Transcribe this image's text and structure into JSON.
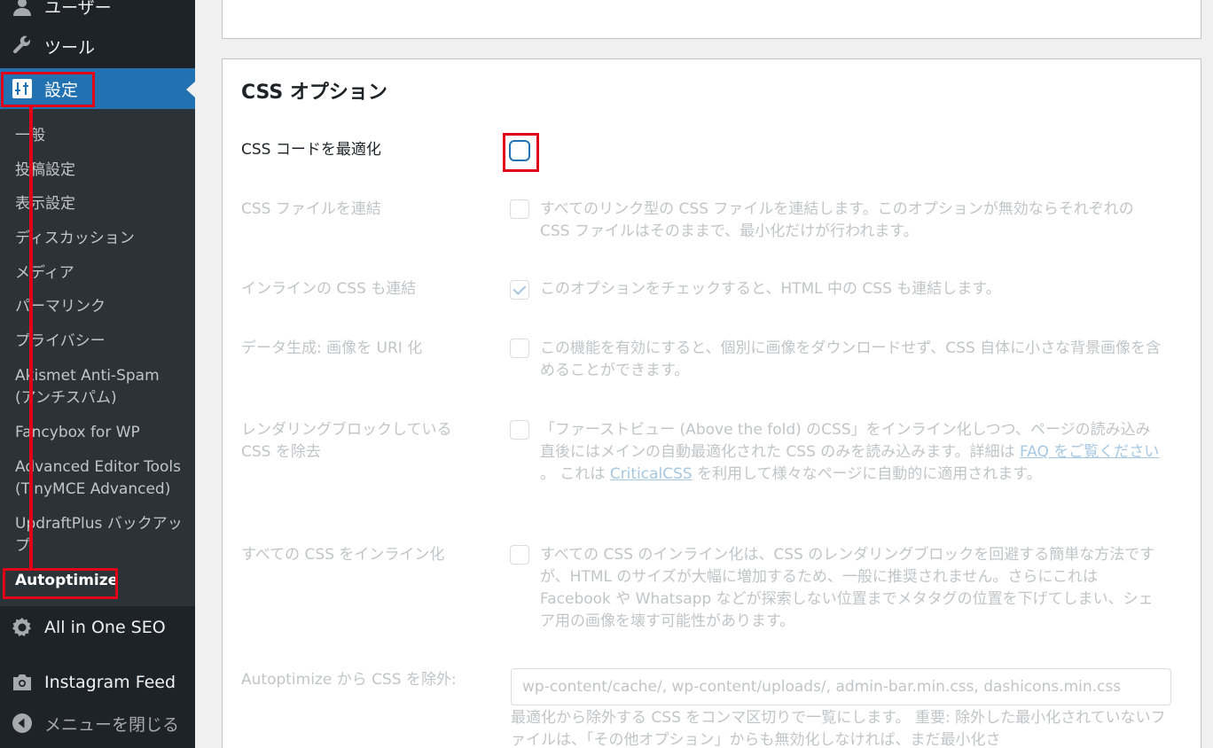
{
  "sidebar": {
    "users_label": "ユーザー",
    "tools_label": "ツール",
    "settings_label": "設定",
    "submenu": [
      "一般",
      "投稿設定",
      "表示設定",
      "ディスカッション",
      "メディア",
      "パーマリンク",
      "プライバシー",
      "Akismet Anti-Spam (アンチスパム)",
      "Fancybox for WP",
      "Advanced Editor Tools (TinyMCE Advanced)",
      "UpdraftPlus バックアップ",
      "Autoptimize"
    ],
    "aioseo_label": "All in One SEO",
    "instagram_label": "Instagram Feed",
    "collapse_label": "メニューを閉じる"
  },
  "css_options": {
    "title": "CSS オプション",
    "optimize": {
      "label": "CSS コードを最適化",
      "checked": false
    },
    "aggregate": {
      "label": "CSS ファイルを連結",
      "checked": false,
      "desc": "すべてのリンク型の CSS ファイルを連結します。このオプションが無効ならそれぞれの CSS ファイルはそのままで、最小化だけが行われます。"
    },
    "inline_aggregate": {
      "label": "インラインの CSS も連結",
      "checked": true,
      "desc": "このオプションをチェックすると、HTML 中の CSS も連結します。"
    },
    "datauri": {
      "label": "データ生成: 画像を URI 化",
      "checked": false,
      "desc": "この機能を有効にすると、個別に画像をダウンロードせず、CSS 自体に小さな背景画像を含めることができます。"
    },
    "render_blocking": {
      "label": "レンダリングブロックしている CSS を除去",
      "checked": false,
      "desc_before": "「ファーストビュー (Above the fold) のCSS」をインライン化しつつ、ページの読み込み直後にはメインの自動最適化された CSS のみを読み込みます。詳細は ",
      "faq_link": "FAQ をご覧ください",
      "desc_middle": " 。 これは ",
      "criticalcss_link": "CriticalCSS",
      "desc_after": " を利用して様々なページに自動的に適用されます。"
    },
    "inline_all": {
      "label": "すべての CSS をインライン化",
      "checked": false,
      "desc": "すべての CSS のインライン化は、CSS のレンダリングブロックを回避する簡単な方法ですが、HTML のサイズが大幅に増加するため、一般に推奨されません。さらにこれは Facebook や Whatsapp などが探索しない位置までメタタグの位置を下げてしまい、シェア用の画像を壊す可能性があります。"
    },
    "exclude": {
      "label": "Autoptimize から CSS を除外:",
      "value": "wp-content/cache/, wp-content/uploads/, admin-bar.min.css, dashicons.min.css",
      "help": "最適化から除外する CSS をコンマ区切りで一覧にします。 重要: 除外した最小化されていないファイルは、「その他オプション」からも無効化しなければ、まだ最小化さ"
    }
  },
  "colors": {
    "sidebar_bg": "#1d2327",
    "submenu_bg": "#2c3338",
    "accent": "#2271b1",
    "highlight_red": "#e00018"
  }
}
